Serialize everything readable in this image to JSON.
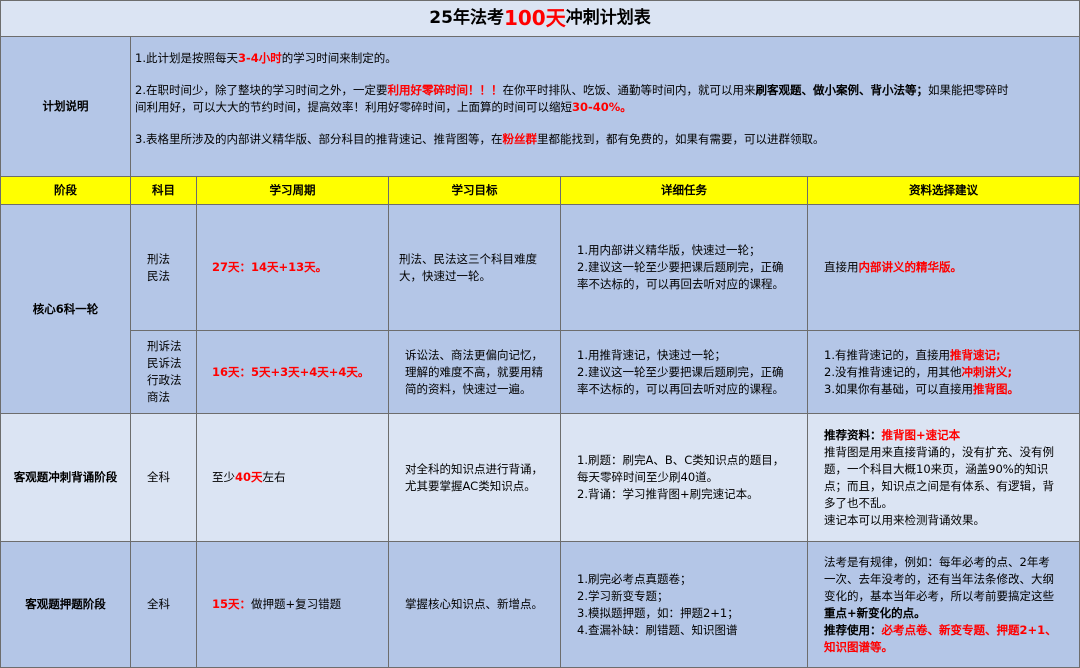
{
  "title": {
    "prefix": "25年法考",
    "highlight": "100天",
    "suffix": "冲刺计划表"
  },
  "plan": {
    "label": "计划说明",
    "p1": {
      "a": "1.此计划是按照每天",
      "b": "3-4小时",
      "c": "的学习时间来制定的。"
    },
    "p2": {
      "a": "2.在职时间少，除了整块的学习时间之外，一定要",
      "b": "利用好零碎时间！！！",
      "c": "在你平时排队、吃饭、通勤等时间内，就可以用来",
      "d": "刷客观题、做小案例、背小法等；",
      "e": "如果能把零碎时",
      "line2a": "间利用好，可以大大的节约时间，提高效率！利用好零碎时间，上面算的时间可以缩短",
      "line2b": "30-40%。"
    },
    "p3": {
      "a": "3.表格里所涉及的内部讲义精华版、部分科目的推背速记、推背图等，在",
      "b": "粉丝群",
      "c": "里都能找到，都有免费的，如果有需要，可以进群领取。"
    }
  },
  "headers": [
    "阶段",
    "科目",
    "学习周期",
    "学习目标",
    "详细任务",
    "资料选择建议"
  ],
  "rows": {
    "stage1": "核心6科一轮",
    "r1": {
      "subjects": [
        "刑法",
        "民法"
      ],
      "period": "27天：14天+13天。",
      "goal": [
        "刑法、民法这三个科目难度",
        "大，快速过一轮。"
      ],
      "tasks": [
        "1.用内部讲义精华版，快速过一轮；",
        "2.建议这一轮至少要把课后题刷完，正确",
        "率不达标的，可以再回去听对应的课程。"
      ],
      "advice": {
        "a": "直接用",
        "b": "内部讲义的精华版。"
      }
    },
    "r2": {
      "subjects": [
        "刑诉法",
        "民诉法",
        "行政法",
        "商法"
      ],
      "period": "16天：5天+3天+4天+4天。",
      "goal": [
        "诉讼法、商法更偏向记忆，",
        "理解的难度不高，就要用精",
        "简的资料，快速过一遍。"
      ],
      "tasks": [
        "1.用推背速记，快速过一轮；",
        "2.建议这一轮至少要把课后题刷完，正确",
        "率不达标的，可以再回去听对应的课程。"
      ],
      "advice": [
        {
          "a": "1.有推背速记的，直接用",
          "b": "推背速记;"
        },
        {
          "a": "2.没有推背速记的，用其他",
          "b": "冲刺讲义;"
        },
        {
          "a": "3.如果你有基础，可以直接用",
          "b": "推背图。"
        }
      ]
    },
    "r3": {
      "stage": "客观题冲刺背诵阶段",
      "subject": "全科",
      "period": {
        "a": "至少",
        "b": "40天",
        "c": "左右"
      },
      "goal": [
        "对全科的知识点进行背诵，",
        "尤其要掌握AC类知识点。"
      ],
      "tasks": [
        "1.刷题：刷完A、B、C类知识点的题目，",
        "每天零碎时间至少刷40道。",
        "2.背诵：学习推背图+刷完速记本。"
      ],
      "advice": {
        "head_a": "推荐资料：",
        "head_b": "推背图+速记本",
        "lines": [
          "推背图是用来直接背诵的，没有扩充、没有例",
          "题，一个科目大概10来页，涵盖90%的知识",
          "点；而且，知识点之间是有体系、有逻辑，背",
          "多了也不乱。",
          "速记本可以用来检测背诵效果。"
        ]
      }
    },
    "r4": {
      "stage": "客观题押题阶段",
      "subject": "全科",
      "period": {
        "a": "15天：",
        "b": "做押题+复习错题"
      },
      "goal": "掌握核心知识点、新增点。",
      "tasks": [
        "1.刷完必考点真题卷；",
        "2.学习新变专题；",
        "3.模拟题押题，如：押题2+1；",
        "4.查漏补缺：刷错题、知识图谱"
      ],
      "advice": {
        "lines": [
          "法考是有规律，例如：每年必考的点、2年考",
          "一次、去年没考的，还有当年法条修改、大纲",
          "变化的，基本当年必考，所以考前要搞定这些"
        ],
        "bold_line": "重点+新变化的点。",
        "rec_a": "推荐使用：",
        "rec_b": "必考点卷、新变专题、押题2+1、",
        "rec_c": "知识图谱等。"
      }
    }
  }
}
